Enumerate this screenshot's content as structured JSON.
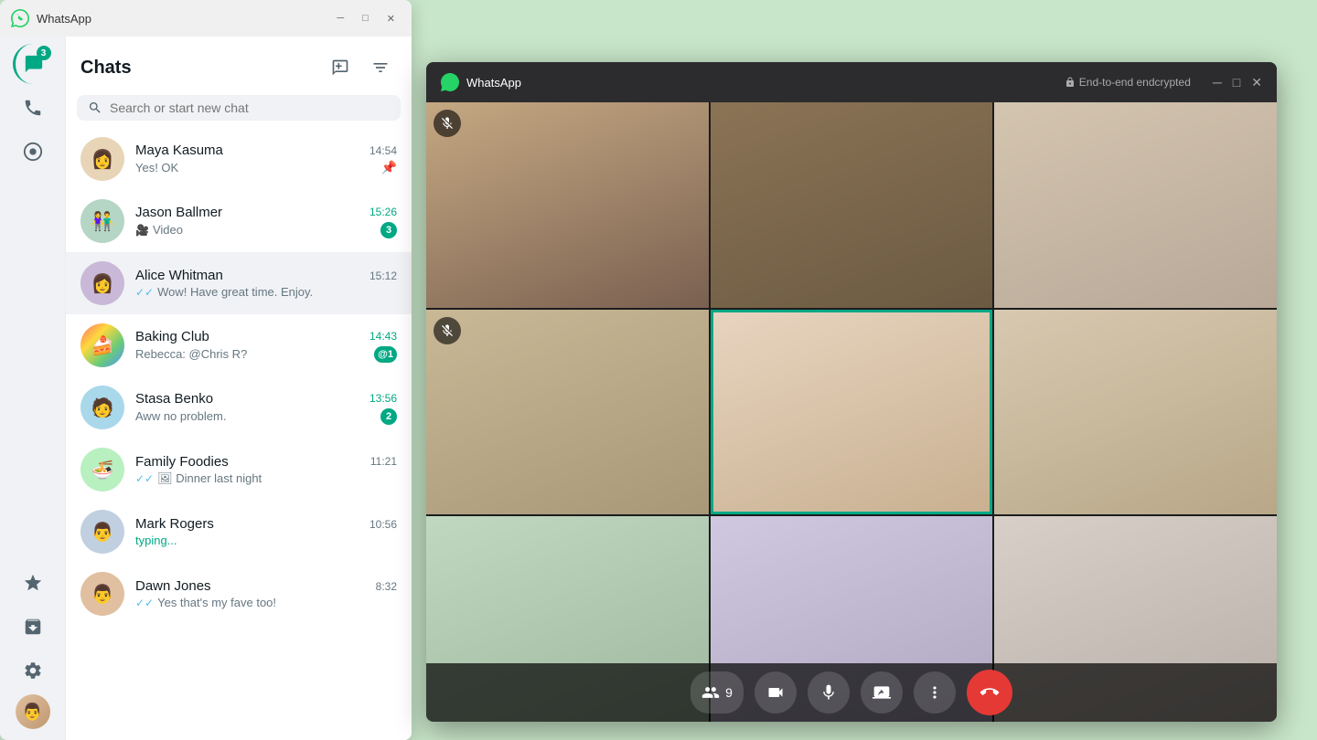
{
  "app": {
    "title": "WhatsApp",
    "call_window_title": "WhatsApp",
    "encryption_text": "End-to-end endcrypted"
  },
  "sidebar": {
    "chats_badge": "3",
    "items": [
      {
        "name": "chats",
        "label": "Chats",
        "active": true
      },
      {
        "name": "calls",
        "label": "Calls"
      },
      {
        "name": "status",
        "label": "Status"
      }
    ]
  },
  "chats_panel": {
    "title": "Chats",
    "new_chat_label": "New chat",
    "filter_label": "Filter",
    "search_placeholder": "Search or start new chat"
  },
  "chat_list": [
    {
      "id": "maya",
      "name": "Maya Kasuma",
      "time": "14:54",
      "preview": "Yes! OK",
      "pinned": true,
      "avatar_emoji": "👩"
    },
    {
      "id": "jason",
      "name": "Jason Ballmer",
      "time": "15:26",
      "preview": "Video",
      "unread": 3,
      "avatar_emoji": "👫"
    },
    {
      "id": "alice",
      "name": "Alice Whitman",
      "time": "15:12",
      "preview": "Wow! Have great time. Enjoy.",
      "double_tick": true,
      "active": true,
      "avatar_emoji": "👩"
    },
    {
      "id": "baking",
      "name": "Baking Club",
      "time": "14:43",
      "preview": "Rebecca: @Chris R?",
      "unread": 1,
      "mention": true,
      "avatar_emoji": "🍰"
    },
    {
      "id": "stasa",
      "name": "Stasa Benko",
      "time": "13:56",
      "preview": "Aww no problem.",
      "unread": 2,
      "avatar_emoji": "🧑"
    },
    {
      "id": "family",
      "name": "Family Foodies",
      "time": "11:21",
      "preview": "Dinner last night",
      "double_tick": true,
      "has_image": true,
      "avatar_emoji": "🍜"
    },
    {
      "id": "mark",
      "name": "Mark Rogers",
      "time": "10:56",
      "preview": "typing...",
      "typing": true,
      "avatar_emoji": "👨"
    },
    {
      "id": "dawn",
      "name": "Dawn Jones",
      "time": "8:32",
      "preview": "Yes that's my fave too!",
      "double_tick": true,
      "avatar_emoji": "👨"
    }
  ],
  "call": {
    "participants_count": "9",
    "participants": [
      {
        "id": 1,
        "muted": true
      },
      {
        "id": 2,
        "muted": false
      },
      {
        "id": 3,
        "muted": false
      },
      {
        "id": 4,
        "muted": true
      },
      {
        "id": 5,
        "muted": false,
        "highlighted": true
      },
      {
        "id": 6,
        "muted": false
      },
      {
        "id": 7,
        "muted": false
      },
      {
        "id": 8,
        "muted": false
      },
      {
        "id": 9,
        "muted": false
      }
    ],
    "controls": {
      "participants_label": "9",
      "end_call_label": "End call"
    }
  }
}
